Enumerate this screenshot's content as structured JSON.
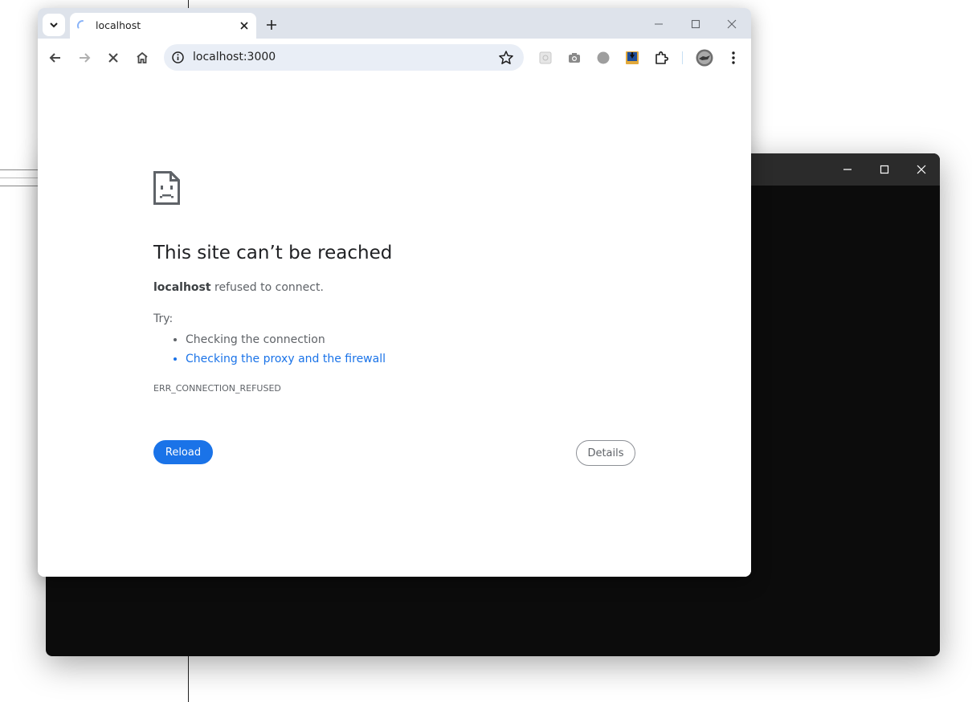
{
  "browser": {
    "tab": {
      "title": "localhost"
    },
    "address_bar": {
      "url": "localhost:3000"
    },
    "accent": "#1a73e8"
  },
  "error_page": {
    "heading": "This site can’t be reached",
    "host": "localhost",
    "message": " refused to connect.",
    "try_label": "Try:",
    "suggestions": [
      "Checking the connection",
      "Checking the proxy and the firewall"
    ],
    "error_code": "ERR_CONNECTION_REFUSED",
    "reload_label": "Reload",
    "details_label": "Details"
  },
  "icons": [
    "tab-search-icon",
    "loading-spinner-icon",
    "close-icon",
    "plus-icon",
    "minimize-icon",
    "maximize-icon",
    "back-arrow-icon",
    "forward-arrow-icon",
    "stop-icon",
    "home-icon",
    "info-icon",
    "star-icon",
    "extension-icon",
    "camera-icon",
    "record-icon",
    "download-icon",
    "puzzle-icon",
    "avatar",
    "more-vert-icon",
    "sad-page-icon"
  ],
  "terminal": {
    "background": "#0c0c0c"
  }
}
